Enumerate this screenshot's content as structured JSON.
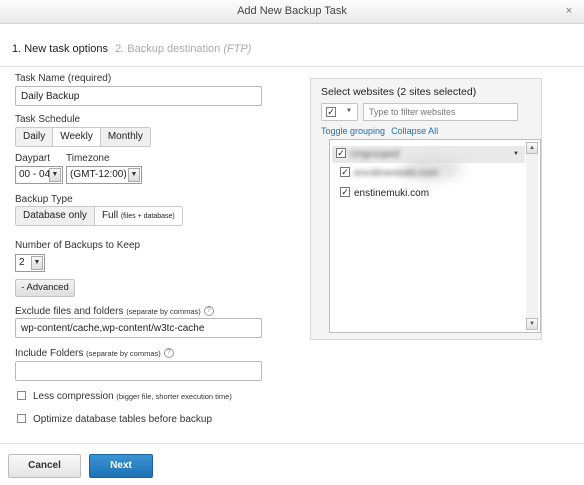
{
  "window": {
    "title": "Add New Backup Task",
    "close_glyph": "×"
  },
  "steps": {
    "active": "1. New task options",
    "inactive_main": "2. Backup destination",
    "inactive_sub": "(FTP)"
  },
  "task_name": {
    "label": "Task Name (required)",
    "value": "Daily Backup"
  },
  "task_schedule": {
    "label": "Task Schedule",
    "options": [
      "Daily",
      "Weekly",
      "Monthly"
    ],
    "selected": "Daily"
  },
  "daypart": {
    "label": "Daypart",
    "value": "00 - 04"
  },
  "timezone": {
    "label": "Timezone",
    "value": "(GMT-12:00)"
  },
  "backup_type": {
    "label": "Backup Type",
    "option_database": "Database only",
    "option_full": "Full",
    "option_full_note": "(files + database)"
  },
  "num_backups": {
    "label": "Number of Backups to Keep",
    "value": "2"
  },
  "advanced_button": "- Advanced",
  "exclude": {
    "label": "Exclude files and folders",
    "note": "(separate by commas)",
    "value": "wp-content/cache,wp-content/w3tc-cache"
  },
  "include": {
    "label": "Include Folders",
    "note": "(separate by commas)",
    "value": ""
  },
  "less_compression": {
    "label": "Less compression",
    "note": "(bigger file, shorter execution time)",
    "checked": false
  },
  "optimize_tables": {
    "label": "Optimize database tables before backup",
    "checked": false
  },
  "buttons": {
    "cancel": "Cancel",
    "next": "Next"
  },
  "websites": {
    "title": "Select websites (2 sites selected)",
    "select_all_checked": true,
    "filter_placeholder": "Type to filter websites",
    "toggle_grouping": "Toggle grouping",
    "collapse_all": "Collapse All",
    "group_label": "Ungrouped",
    "sites": [
      {
        "name": "enrollmentsite.com",
        "checked": true,
        "blurred": true
      },
      {
        "name": "enstinemuki.com",
        "checked": true,
        "blurred": false
      }
    ]
  },
  "colors": {
    "next_button": "#2a82c7",
    "link": "#1f6fb2",
    "panel_bg": "#f4f4f4"
  }
}
